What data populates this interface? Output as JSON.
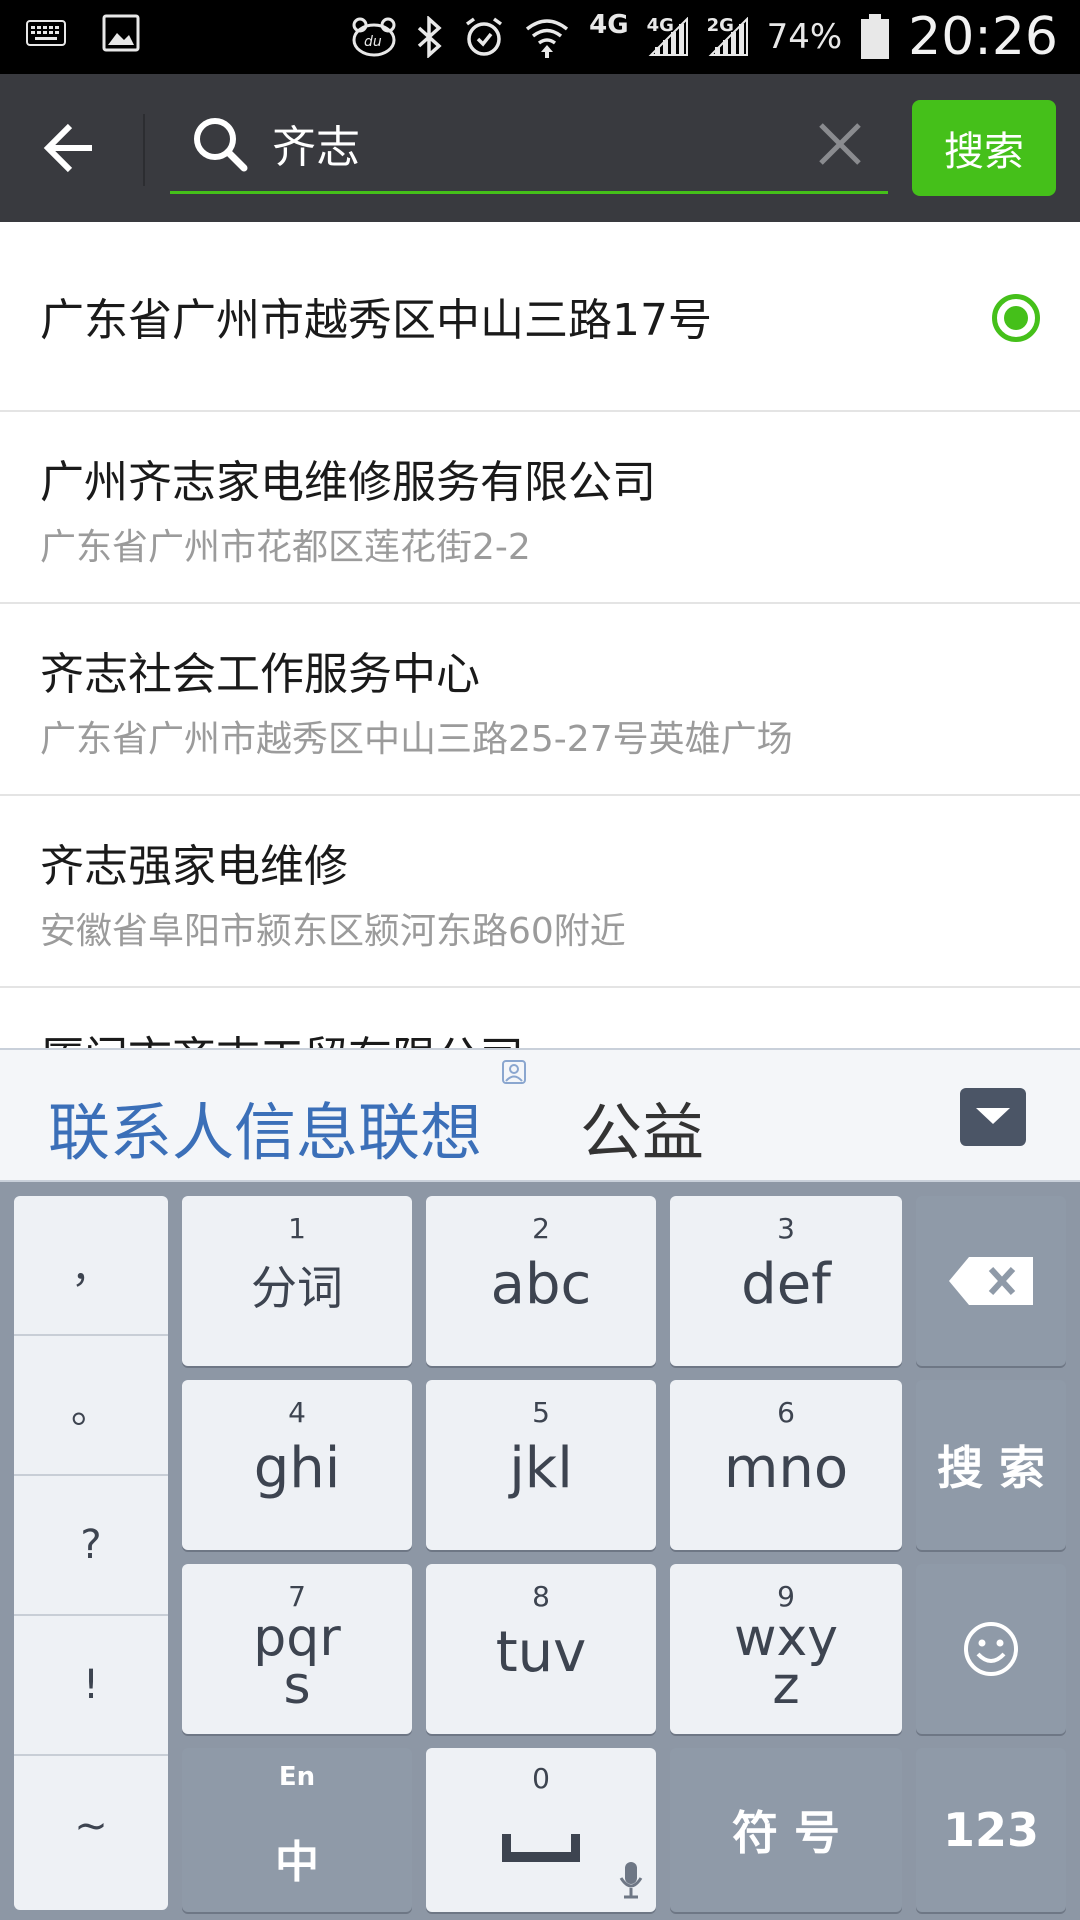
{
  "status_bar": {
    "network_4g": "4G",
    "sim1_label": "4G",
    "sim2_label": "2G",
    "battery": "74%",
    "time": "20:26"
  },
  "search": {
    "query": "齐志",
    "button_label": "搜索"
  },
  "results": [
    {
      "title": "广东省广州市越秀区中山三路17号",
      "subtitle": "",
      "selected": true
    },
    {
      "title": "广州齐志家电维修服务有限公司",
      "subtitle": "广东省广州市花都区莲花街2-2",
      "selected": false
    },
    {
      "title": "齐志社会工作服务中心",
      "subtitle": "广东省广州市越秀区中山三路25-27号英雄广场",
      "selected": false
    },
    {
      "title": "齐志强家电维修",
      "subtitle": "安徽省阜阳市颍东区颍河东路60附近",
      "selected": false
    },
    {
      "title": "厦门市齐志工贸有限公司",
      "subtitle": "",
      "selected": false
    }
  ],
  "candidates": {
    "first": "联系人信息联想",
    "second": "公益"
  },
  "keyboard": {
    "punctuation": [
      "，",
      "。",
      "?",
      "!",
      "~"
    ],
    "keys": [
      {
        "num": "1",
        "label": "分词"
      },
      {
        "num": "2",
        "label": "abc"
      },
      {
        "num": "3",
        "label": "def"
      },
      {
        "num": "4",
        "label": "ghi"
      },
      {
        "num": "5",
        "label": "jkl"
      },
      {
        "num": "6",
        "label": "mno"
      },
      {
        "num": "7",
        "label_line1": "pqr",
        "label_line2": "s"
      },
      {
        "num": "8",
        "label": "tuv"
      },
      {
        "num": "9",
        "label_line1": "wxy",
        "label_line2": "z"
      }
    ],
    "search_key": "搜 索",
    "lang_en": "En",
    "lang_zh": "中",
    "zero_num": "0",
    "symbol_key": "符 号",
    "number_key": "123"
  },
  "colors": {
    "accent_green": "#45c01a",
    "toolbar_bg": "#393a3f",
    "candidate_blue": "#3b6fb8",
    "keyboard_bg": "#8d97a5"
  }
}
